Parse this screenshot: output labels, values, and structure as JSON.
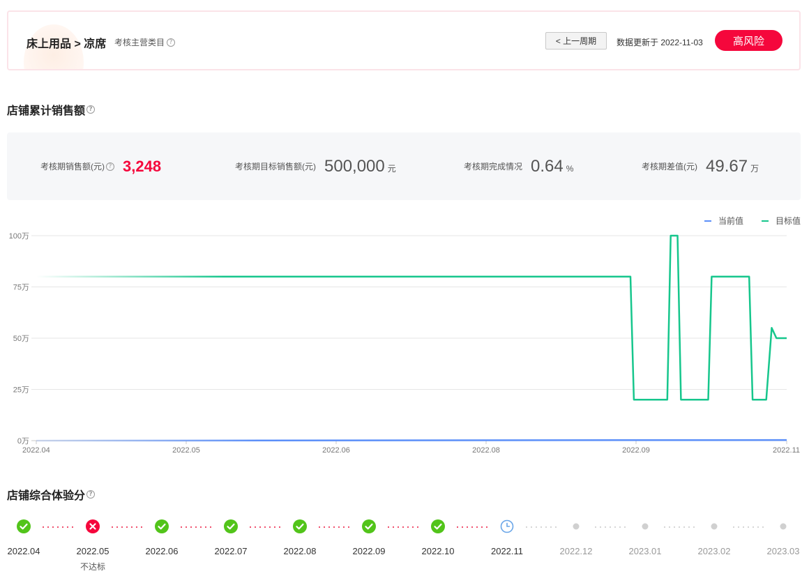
{
  "header": {
    "breadcrumb": "床上用品 > 凉席",
    "category_label": "考核主营类目",
    "prev_button": "< 上一周期",
    "update_text": "数据更新于 2022-11-03",
    "risk_badge": "高风险"
  },
  "sales_section": {
    "title": "店铺累计销售额"
  },
  "stats": [
    {
      "label": "考核期销售额(元)",
      "value": "3,248",
      "unit": "",
      "highlight": true,
      "help": true
    },
    {
      "label": "考核期目标销售额(元)",
      "value": "500,000",
      "unit": "元",
      "highlight": false,
      "help": false
    },
    {
      "label": "考核期完成情况",
      "value": "0.64",
      "unit": "%",
      "highlight": false,
      "help": false
    },
    {
      "label": "考核期差值(元)",
      "value": "49.67",
      "unit": "万",
      "highlight": false,
      "help": false
    }
  ],
  "chart_data": {
    "type": "line",
    "x_tick_labels": [
      "2022.04",
      "2022.05",
      "2022.06",
      "2022.08",
      "2022.09",
      "2022.11"
    ],
    "y_tick_labels": [
      "0万",
      "25万",
      "50万",
      "75万",
      "100万"
    ],
    "ylim": [
      0,
      100
    ],
    "grid": true,
    "legend_position": "top-right",
    "series": [
      {
        "name": "当前值",
        "color": "#5b8ff9",
        "x": [
          0,
          1.0
        ],
        "y": [
          0,
          0.32
        ]
      },
      {
        "name": "目标值",
        "color": "#16c68c",
        "x": [
          0,
          0.871,
          0.876,
          0.925,
          0.93,
          0.94,
          0.945,
          0.985,
          0.99,
          1.045,
          1.05,
          1.07,
          1.078,
          1.085,
          1.093,
          1.1
        ],
        "y": [
          80,
          80,
          20,
          20,
          100,
          100,
          20,
          20,
          80,
          80,
          20,
          20,
          55,
          50,
          50,
          50
        ]
      }
    ]
  },
  "score_section": {
    "title": "店铺综合体验分"
  },
  "timeline": [
    {
      "month": "2022.04",
      "status": "pass",
      "sub": ""
    },
    {
      "month": "2022.05",
      "status": "fail",
      "sub": "不达标"
    },
    {
      "month": "2022.06",
      "status": "pass",
      "sub": ""
    },
    {
      "month": "2022.07",
      "status": "pass",
      "sub": ""
    },
    {
      "month": "2022.08",
      "status": "pass",
      "sub": ""
    },
    {
      "month": "2022.09",
      "status": "pass",
      "sub": ""
    },
    {
      "month": "2022.10",
      "status": "pass",
      "sub": ""
    },
    {
      "month": "2022.11",
      "status": "current",
      "sub": ""
    },
    {
      "month": "2022.12",
      "status": "future",
      "sub": ""
    },
    {
      "month": "2023.01",
      "status": "future",
      "sub": ""
    },
    {
      "month": "2023.02",
      "status": "future",
      "sub": ""
    },
    {
      "month": "2023.03",
      "status": "future",
      "sub": ""
    }
  ],
  "colors": {
    "accent_red": "#f5073c",
    "pass_green": "#52c41a",
    "fail_red": "#f5073c",
    "current_blue": "#6aa6e8",
    "future_gray": "#d0d0d0"
  }
}
